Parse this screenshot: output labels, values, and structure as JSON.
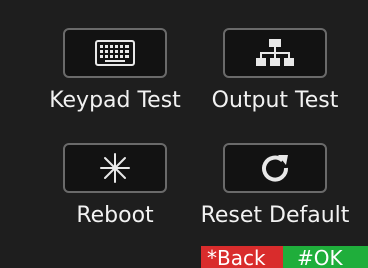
{
  "menu": {
    "items": [
      {
        "label": "Keypad Test",
        "icon": "keyboard-icon"
      },
      {
        "label": "Output Test",
        "icon": "hierarchy-icon"
      },
      {
        "label": "Reboot",
        "icon": "asterisk-icon"
      },
      {
        "label": "Reset Default",
        "icon": "refresh-icon"
      }
    ]
  },
  "softkeys": {
    "back_label": "*Back",
    "ok_label": "#OK"
  },
  "colors": {
    "background": "#1e1e1e",
    "back_key": "#d92c2c",
    "ok_key": "#1fae3b",
    "button_border": "#6a6a6a"
  }
}
